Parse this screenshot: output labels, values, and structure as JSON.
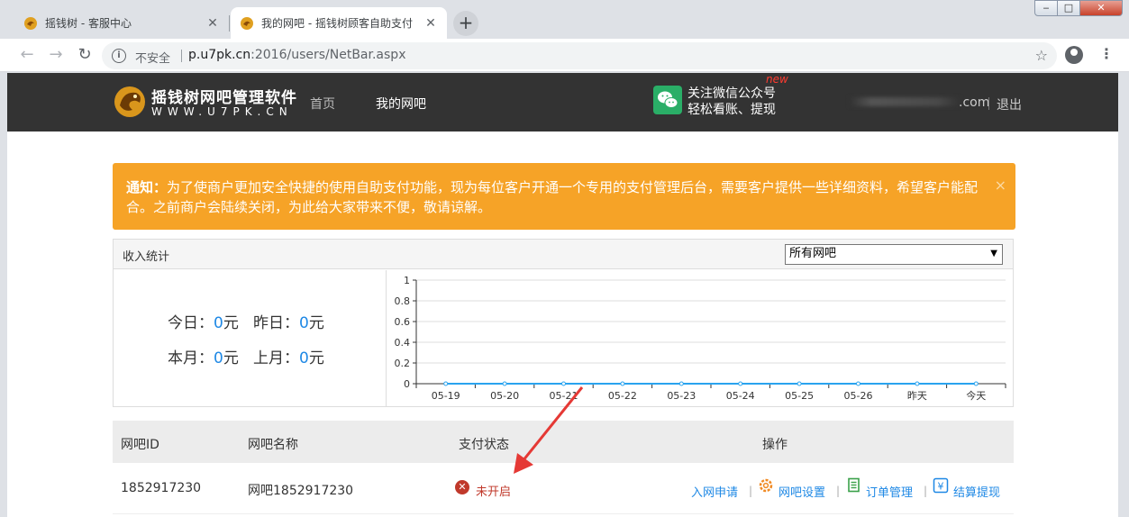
{
  "browser": {
    "tabs": [
      {
        "title": "摇钱树 - 客服中心",
        "active": false
      },
      {
        "title": "我的网吧 - 摇钱树顾客自助支付",
        "active": true
      }
    ],
    "omnibox": {
      "insecure_label": "不安全",
      "url_host": "p.u7pk.cn",
      "url_path": ":2016/users/NetBar.aspx"
    }
  },
  "header": {
    "brand_name": "摇钱树网吧管理软件",
    "brand_url": "WWW.U7PK.CN",
    "nav": [
      "首页",
      "我的网吧"
    ],
    "wechat_line1": "关注微信公众号",
    "wechat_line2": "轻松看账、提现",
    "new_badge": "new",
    "user_suffix": ".com",
    "logout": "退出"
  },
  "notice": {
    "label": "通知：",
    "text": "为了使商户更加安全快捷的使用自助支付功能，现为每位客户开通一个专用的支付管理后台，需要客户提供一些详细资料，希望客户能配合。之前商户会陆续关闭，为此给大家带来不便，敬请谅解。",
    "close": "×"
  },
  "stats": {
    "title": "收入统计",
    "select_value": "所有网吧",
    "today_label": "今日：",
    "today_value": "0",
    "unit": "元",
    "yesterday_label": "昨日：",
    "yesterday_value": "0",
    "month_label": "本月：",
    "month_value": "0",
    "lastmonth_label": "上月：",
    "lastmonth_value": "0"
  },
  "chart_data": {
    "type": "line",
    "categories": [
      "05-19",
      "05-20",
      "05-21",
      "05-22",
      "05-23",
      "05-24",
      "05-25",
      "05-26",
      "昨天",
      "今天"
    ],
    "series": [
      {
        "values": [
          0,
          0,
          0,
          0,
          0,
          0,
          0,
          0,
          0,
          0
        ]
      }
    ],
    "yticks": [
      "0",
      "0.2",
      "0.4",
      "0.6",
      "0.8",
      "1"
    ],
    "ylim": [
      0,
      1
    ],
    "grid": true,
    "color": "#29a3ef"
  },
  "table": {
    "headers": [
      "网吧ID",
      "网吧名称",
      "支付状态",
      "操作"
    ],
    "rows": [
      {
        "id": "1852917230",
        "name": "网吧1852917230",
        "status": "未开启",
        "ops": [
          "入网申请",
          "网吧设置",
          "订单管理",
          "结算提现"
        ]
      }
    ]
  },
  "colors": {
    "header_bg": "#333333",
    "notice_bg": "#f6a327",
    "link": "#1e88e5",
    "status_off": "#c0392b",
    "wechat": "#2aae67",
    "annotation_arrow": "#e53935"
  }
}
